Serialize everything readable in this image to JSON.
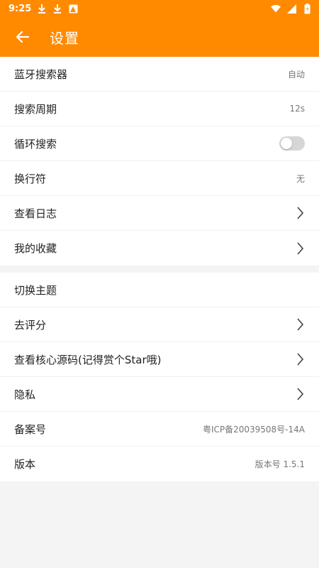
{
  "status_bar": {
    "time": "9:25",
    "icons_left": [
      "download-icon",
      "download-icon",
      "image-notification-icon"
    ],
    "icons_right": [
      "wifi-icon",
      "signal-icon",
      "battery-icon"
    ]
  },
  "app_bar": {
    "title": "设置",
    "back_icon": "arrow-left-icon",
    "color": "#ff8a00"
  },
  "groups": [
    {
      "items": [
        {
          "label": "蓝牙搜索器",
          "type": "value",
          "value": "自动"
        },
        {
          "label": "搜索周期",
          "type": "value",
          "value": "12s"
        },
        {
          "label": "循环搜索",
          "type": "toggle",
          "enabled": false
        },
        {
          "label": "换行符",
          "type": "value",
          "value": "无"
        },
        {
          "label": "查看日志",
          "type": "chevron"
        },
        {
          "label": "我的收藏",
          "type": "chevron"
        }
      ]
    },
    {
      "items": [
        {
          "label": "切换主题",
          "type": "plain"
        },
        {
          "label": "去评分",
          "type": "chevron"
        },
        {
          "label": "查看核心源码(记得赏个Star哦)",
          "type": "chevron"
        },
        {
          "label": "隐私",
          "type": "chevron"
        },
        {
          "label": "备案号",
          "type": "value",
          "value": "粤ICP备20039508号-14A"
        },
        {
          "label": "版本",
          "type": "value",
          "value": "版本号 1.5.1"
        }
      ]
    }
  ]
}
